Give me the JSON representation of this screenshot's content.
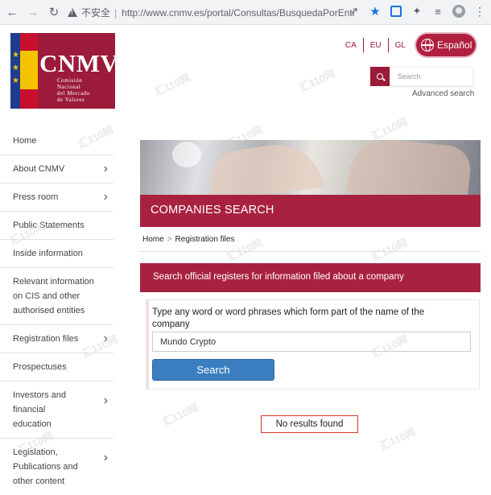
{
  "browser": {
    "security_label": "不安全",
    "url": "http://www.cnmv.es/portal/Consultas/BusquedaPorEnti..."
  },
  "header": {
    "logo_name": "CNMV",
    "logo_sub_1": "Comisión",
    "logo_sub_2": "Nacional",
    "logo_sub_3": "del Mercado",
    "logo_sub_4": "de Valores",
    "languages": [
      "CA",
      "EU",
      "GL"
    ],
    "language_button": "Español",
    "search_placeholder": "Search",
    "advanced_search": "Advanced search"
  },
  "sidebar": {
    "items": [
      {
        "label": "Home",
        "chevron": false
      },
      {
        "label": "About CNMV",
        "chevron": true
      },
      {
        "label": "Press room",
        "chevron": true
      },
      {
        "label": "Public Statements",
        "chevron": false
      },
      {
        "label": "Inside information",
        "chevron": false
      },
      {
        "label": "Relevant information on CIS and other authorised entities",
        "chevron": false
      },
      {
        "label": "Registration files",
        "chevron": true
      },
      {
        "label": "Prospectuses",
        "chevron": false
      },
      {
        "label": "Investors and financial education",
        "chevron": true
      },
      {
        "label": "Legislation, Publications and other content",
        "chevron": true
      }
    ]
  },
  "main": {
    "banner_title": "COMPANIES SEARCH",
    "breadcrumb_home": "Home",
    "breadcrumb_sep": ">",
    "breadcrumb_current": "Registration files",
    "info_text": "Search official registers for information filed about a company",
    "form_label": "Type any word or word phrases which form part of the name of the company",
    "form_value": "Mundo Crypto",
    "search_button": "Search",
    "no_results": "No results found"
  },
  "watermark_text": "汇110网",
  "colors": {
    "brand": "#a8223f",
    "button_blue": "#3a7ebf",
    "alert_border": "#d9362a"
  }
}
